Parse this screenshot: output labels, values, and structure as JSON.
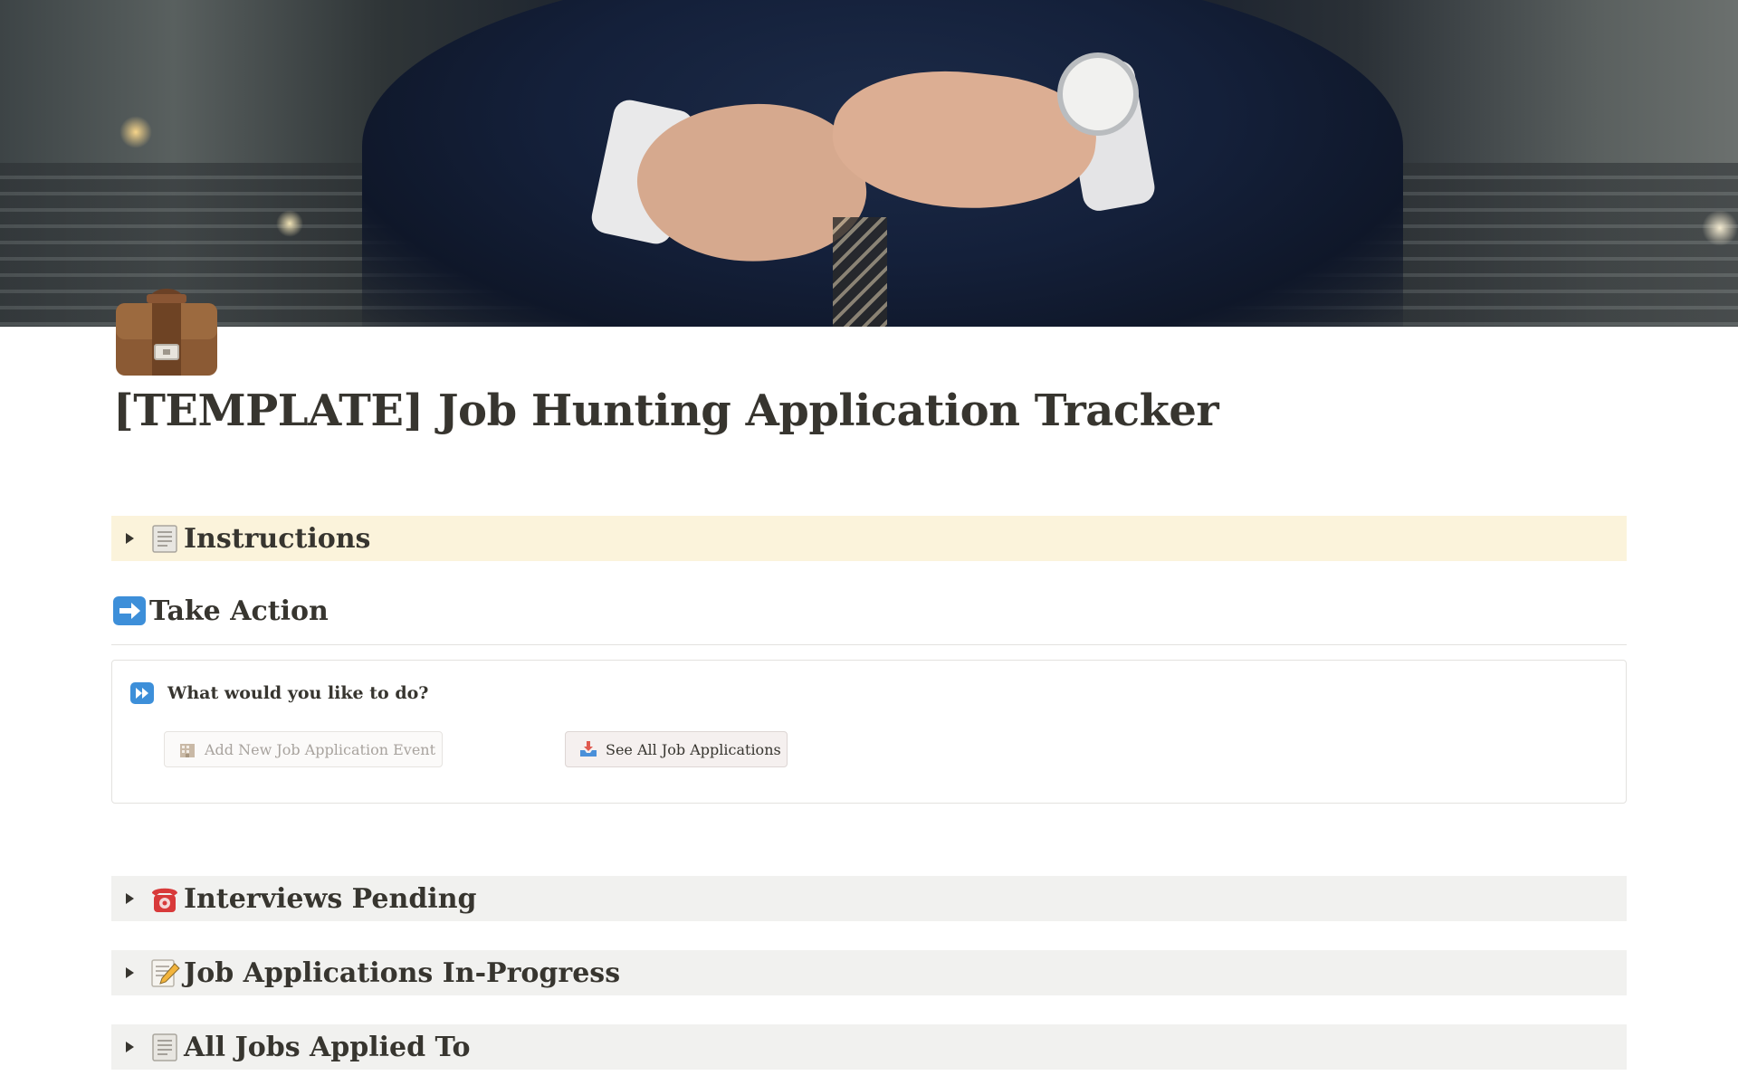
{
  "page": {
    "icon": "briefcase-icon",
    "title": "[TEMPLATE] Job Hunting Application Tracker"
  },
  "toggles": {
    "instructions": {
      "icon": "scroll-icon",
      "label": "Instructions"
    },
    "interviews_pending": {
      "icon": "telephone-icon",
      "label": "Interviews Pending"
    },
    "in_progress": {
      "icon": "memo-icon",
      "label": "Job Applications In-Progress"
    },
    "all_jobs": {
      "icon": "scroll-icon",
      "label": "All Jobs Applied To"
    }
  },
  "take_action": {
    "icon": "right-arrow-icon",
    "heading": "Take Action",
    "callout": {
      "icon": "fast-forward-icon",
      "question": "What would you like to do?",
      "buttons": {
        "add": {
          "icon": "office-building-icon",
          "label": "Add New Job Application Event"
        },
        "see": {
          "icon": "inbox-tray-icon",
          "label": "See All Job Applications"
        }
      }
    }
  },
  "colors": {
    "instructions_bg": "#fbf3db",
    "toggle_gray_bg": "#f1f1ef",
    "text": "#37352f"
  }
}
